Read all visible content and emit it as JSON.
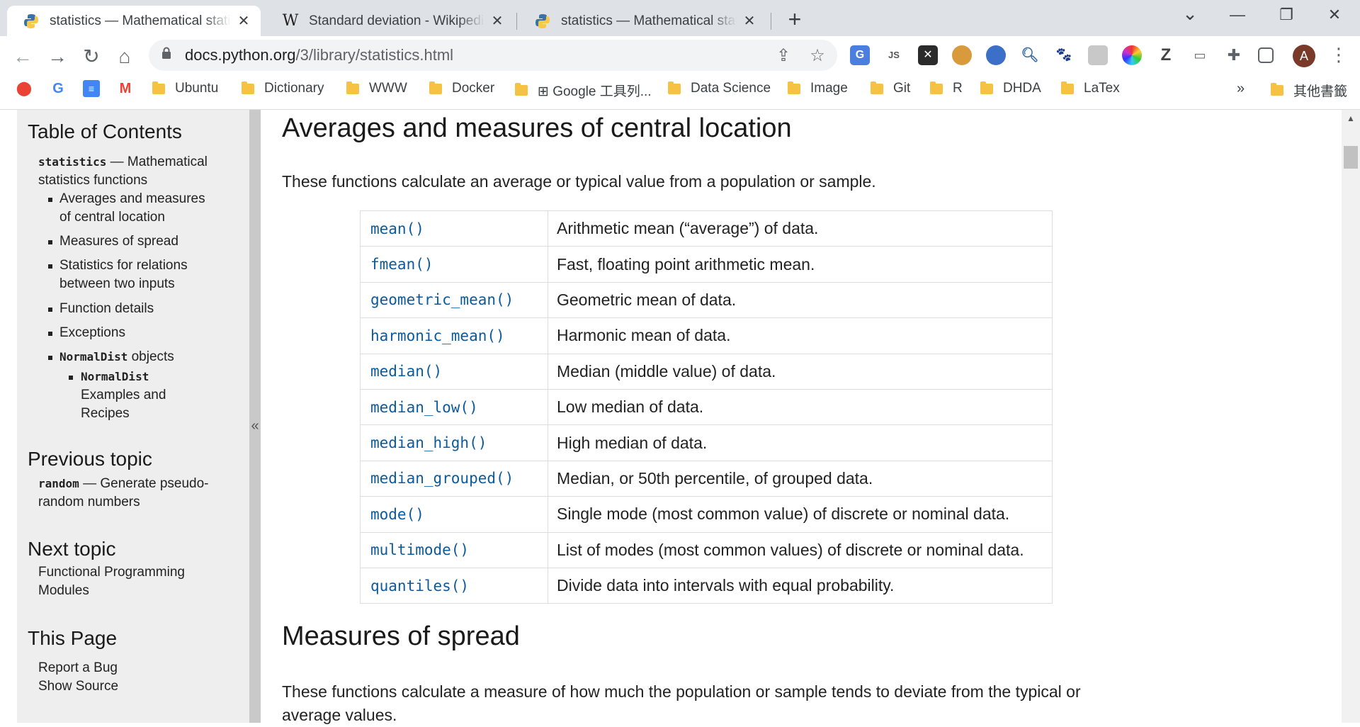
{
  "tabs": [
    {
      "title": "statistics — Mathematical statistics functions",
      "icon": "python-icon",
      "active": true
    },
    {
      "title": "Standard deviation - Wikipedia",
      "icon": "wikipedia-icon",
      "active": false
    },
    {
      "title": "statistics — Mathematical statistics functions",
      "icon": "python-icon",
      "active": false
    }
  ],
  "tab_close_glyph": "✕",
  "new_tab_glyph": "+",
  "window": {
    "dropdown": "⌄",
    "minimize": "—",
    "restore": "❐",
    "close": "✕"
  },
  "nav": {
    "back": "←",
    "forward": "→",
    "reload": "↻",
    "home": "⌂"
  },
  "address": {
    "domain": "docs.python.org",
    "path": "/3/library/statistics.html"
  },
  "profile_initial": "A",
  "bookmarks": [
    "Ubuntu",
    "Dictionary",
    "WWW",
    "Docker",
    "⊞ Google 工具列...",
    "Data Science",
    "Image",
    "Git",
    "R",
    "DHDA",
    "LaTex"
  ],
  "bookmarks_overflow": "»",
  "bookmarks_other": "其他書籤",
  "sidebar": {
    "toc_heading": "Table of Contents",
    "module_name": "statistics",
    "module_desc_1": " — Mathematical",
    "module_desc_2": "statistics functions",
    "items": [
      {
        "line1": "Averages and measures",
        "line2": "of central location"
      },
      {
        "line1": "Measures of spread"
      },
      {
        "line1": "Statistics for relations",
        "line2": "between two inputs"
      },
      {
        "line1": "Function details"
      },
      {
        "line1": "Exceptions"
      }
    ],
    "normaldist_code": "NormalDist",
    "normaldist_rest": " objects",
    "sub_code": "NormalDist",
    "sub_line2": "Examples and",
    "sub_line3": "Recipes",
    "prev_heading": "Previous topic",
    "prev_code": "random",
    "prev_desc_1": " — Generate pseudo-",
    "prev_desc_2": "random numbers",
    "next_heading": "Next topic",
    "next_line1": "Functional Programming",
    "next_line2": "Modules",
    "thispage_heading": "This Page",
    "report_bug": "Report a Bug",
    "show_source": "Show Source",
    "collapse": "«"
  },
  "main": {
    "section1_title": "Averages and measures of central location",
    "section1_intro": "These functions calculate an average or typical value from a population or sample.",
    "functions": [
      {
        "name": "mean()",
        "desc": "Arithmetic mean (“average”) of data."
      },
      {
        "name": "fmean()",
        "desc": "Fast, floating point arithmetic mean."
      },
      {
        "name": "geometric_mean()",
        "desc": "Geometric mean of data."
      },
      {
        "name": "harmonic_mean()",
        "desc": "Harmonic mean of data."
      },
      {
        "name": "median()",
        "desc": "Median (middle value) of data."
      },
      {
        "name": "median_low()",
        "desc": "Low median of data."
      },
      {
        "name": "median_high()",
        "desc": "High median of data."
      },
      {
        "name": "median_grouped()",
        "desc": "Median, or 50th percentile, of grouped data."
      },
      {
        "name": "mode()",
        "desc": "Single mode (most common value) of discrete or nominal data."
      },
      {
        "name": "multimode()",
        "desc": "List of modes (most common values) of discrete or nominal data."
      },
      {
        "name": "quantiles()",
        "desc": "Divide data into intervals with equal probability."
      }
    ],
    "section2_title": "Measures of spread",
    "section2_intro_1": "These functions calculate a measure of how much the population or sample tends to deviate from the typical or",
    "section2_intro_2": "average values."
  }
}
